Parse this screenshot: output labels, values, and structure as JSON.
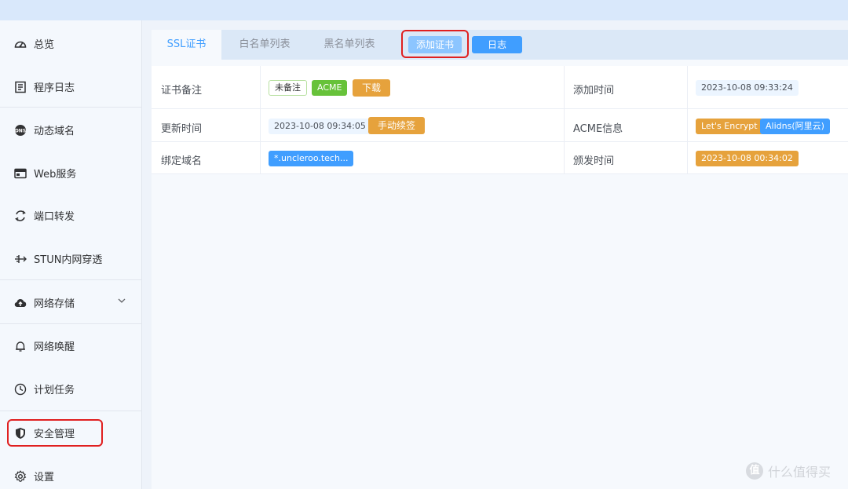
{
  "sidebar": {
    "items": [
      {
        "label": "总览",
        "icon": "dashboard-icon"
      },
      {
        "label": "程序日志",
        "icon": "log-icon"
      },
      {
        "label": "动态域名",
        "icon": "ddns-icon"
      },
      {
        "label": "Web服务",
        "icon": "web-icon"
      },
      {
        "label": "端口转发",
        "icon": "port-forward-icon"
      },
      {
        "label": "STUN内网穿透",
        "icon": "stun-icon"
      },
      {
        "label": "网络存储",
        "icon": "cloud-icon"
      },
      {
        "label": "网络唤醒",
        "icon": "bell-icon"
      },
      {
        "label": "计划任务",
        "icon": "clock-icon"
      },
      {
        "label": "安全管理",
        "icon": "shield-icon"
      },
      {
        "label": "设置",
        "icon": "gear-icon"
      }
    ]
  },
  "tabs": {
    "ssl": "SSL证书",
    "whitelist": "白名单列表",
    "blacklist": "黑名单列表"
  },
  "actions": {
    "add_cert": "添加证书",
    "log": "日志"
  },
  "cert": {
    "remark_label": "证书备注",
    "remark_tag": "未备注",
    "acme_tag": "ACME",
    "download": "下载",
    "added_label": "添加时间",
    "added_value": "2023-10-08 09:33:24",
    "updated_label": "更新时间",
    "updated_value": "2023-10-08 09:34:05",
    "renew": "手动续签",
    "acme_info_label": "ACME信息",
    "acme_provider": "Let's Encrypt",
    "acme_dns": "Alidns(阿里云)",
    "domain_label": "绑定域名",
    "domain_value": "*.uncleroo.tech...",
    "issued_label": "颁发时间",
    "issued_value": "2023-10-08 00:34:02"
  },
  "watermark": {
    "text": "什么值得买",
    "logo": "值"
  },
  "colors": {
    "accent": "#409eff",
    "green": "#67c23a",
    "orange": "#e6a23c",
    "highlight": "#e02020"
  }
}
